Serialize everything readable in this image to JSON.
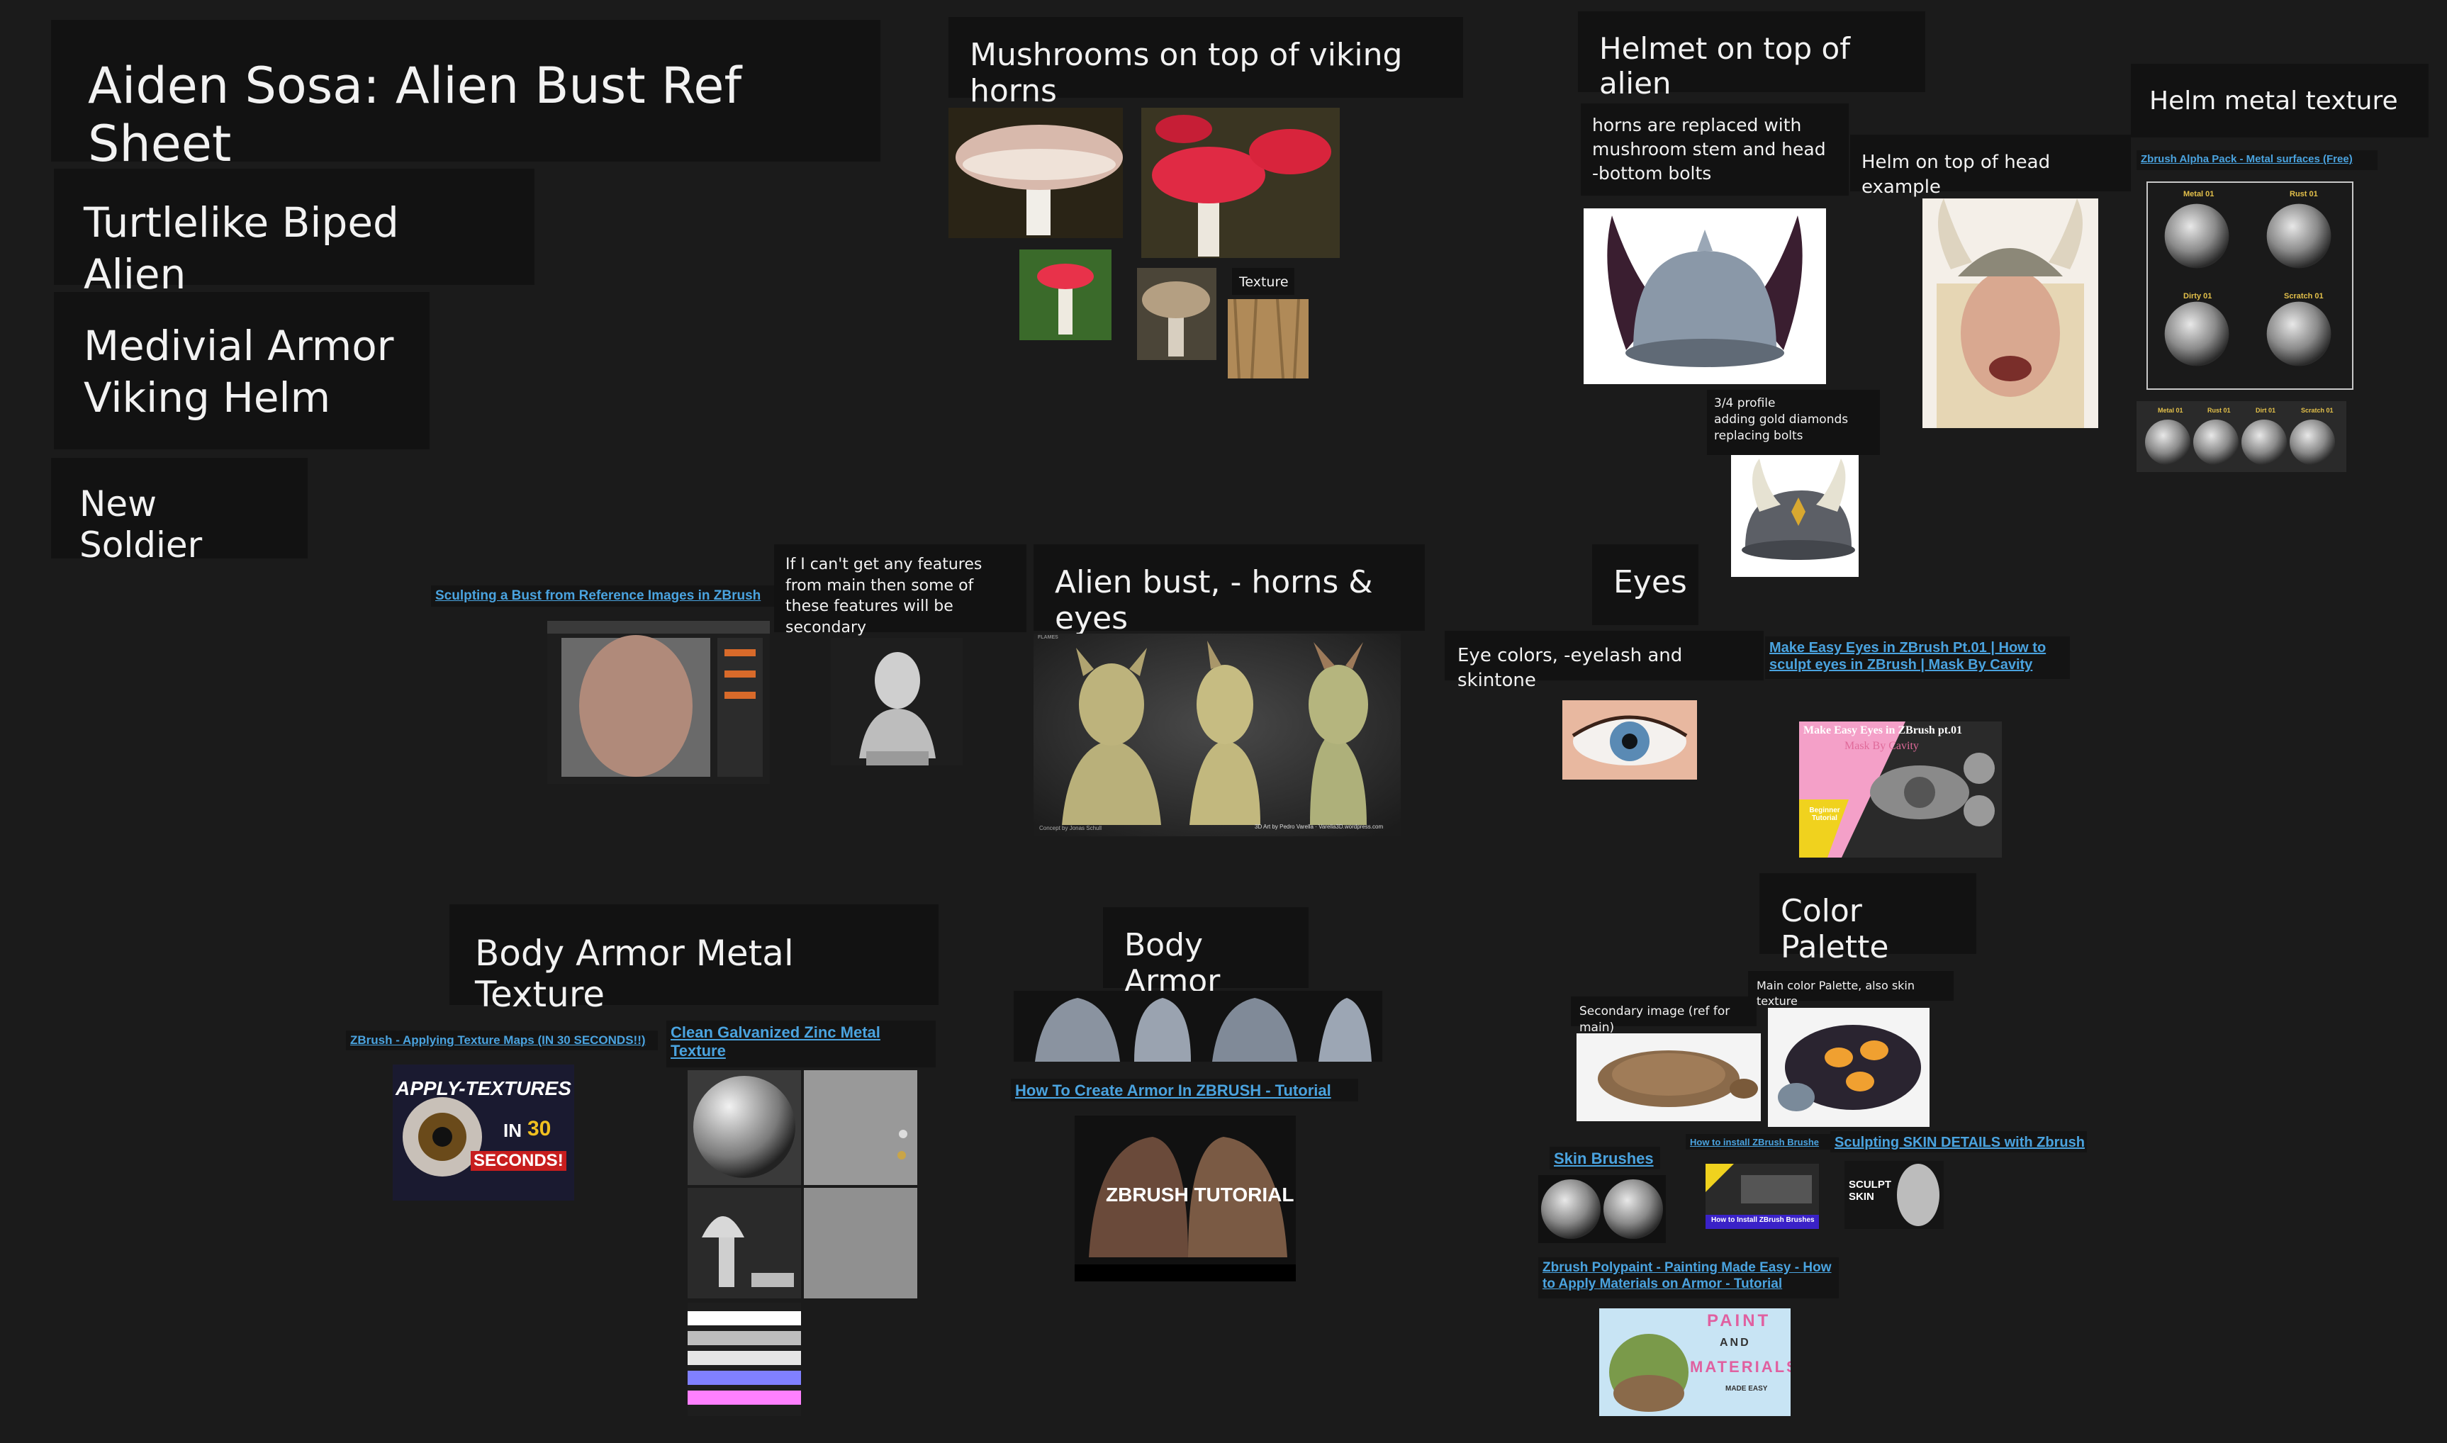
{
  "board": {
    "title": "Aiden Sosa: Alien Bust Ref Sheet",
    "subtitle": "Turtlelike Biped Alien",
    "armor_note": "Medivial Armor\nViking Helm",
    "soldier": "New Soldier"
  },
  "mushrooms": {
    "heading": "Mushrooms on top of viking horns",
    "texture_label": "Texture"
  },
  "helmet": {
    "heading": "Helmet on top of alien",
    "note": "horns are replaced with mushroom stem and head -bottom bolts",
    "head_example": "Helm on top of head example",
    "profile_note": "3/4 profile\nadding gold diamonds\nreplacing bolts"
  },
  "helm_metal": {
    "heading": "Helm metal texture",
    "link": "Zbrush Alpha Pack - Metal surfaces (Free)",
    "swatches": [
      "Metal 01",
      "Rust 01",
      "Dirty 01",
      "Scratch 01"
    ],
    "mini": [
      "Metal 01",
      "Rust 01",
      "Dirt 01",
      "Scratch 01"
    ]
  },
  "bust": {
    "link": "Sculpting a Bust from Reference Images in ZBrush",
    "secondary_note": "If I can't get any features from main then some of these features will be secondary",
    "heading": "Alien bust, - horns & eyes",
    "credit_left": "Concept by Jonas Schull",
    "credit_right": "3D Art by Pedro Varella · Varella3D.wordpress.com",
    "corner": "FLAMES"
  },
  "eyes": {
    "heading": "Eyes",
    "note": "Eye colors, -eyelash and skintone",
    "link": "Make Easy Eyes in ZBrush Pt.01 | How to sculpt eyes in ZBrush | Mask By Cavity",
    "thumb_title": "Make Easy Eyes in ZBrush  pt.01",
    "thumb_sub": "Mask By Cavity",
    "thumb_badge": "Beginner Tutorial"
  },
  "body_metal": {
    "heading": "Body Armor Metal Texture",
    "link1": "ZBrush - Applying Texture Maps (IN 30 SECONDS!!)",
    "link2": "Clean Galvanized Zinc Metal Texture",
    "thumb_line1": "APPLY-TEXTURES",
    "thumb_in": "IN",
    "thumb_num": "30",
    "thumb_seconds": "SECONDS!"
  },
  "body_armor": {
    "heading": "Body Armor",
    "link": "How To Create Armor In ZBRUSH - Tutorial",
    "thumb_text": "ZBRUSH TUTORIAL"
  },
  "palette": {
    "heading": "Color Palette",
    "main_note": "Main color Palette, also skin texture",
    "secondary_note": "Secondary image (ref for main)",
    "skin_brushes": "Skin Brushes",
    "install_link": "How to install ZBrush Brushe",
    "install_thumb": "How to Install ZBrush Brushes",
    "skin_details_link": "Sculpting SKIN DETAILS with Zbrush",
    "sculpt_skin": "SCULPT SKIN",
    "polypaint_link": "Zbrush Polypaint - Painting Made Easy - How to Apply Materials on Armor - Tutorial",
    "paint_word": "PAINT",
    "and_word": "AND",
    "materials_word": "MATERIALS",
    "made_easy": "MADE EASY"
  },
  "colors": {
    "card": "#121212",
    "board": "#1b1b1b",
    "link": "#4aa3df"
  }
}
